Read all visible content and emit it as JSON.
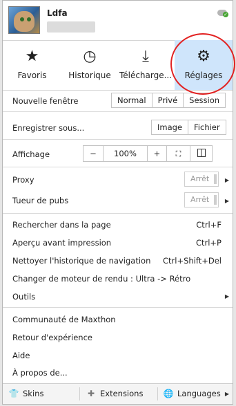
{
  "profile": {
    "username": "Ldfa"
  },
  "quick_actions": [
    {
      "label": "Favoris",
      "icon": "star-icon",
      "glyph": "★"
    },
    {
      "label": "Historique",
      "icon": "clock-icon",
      "glyph": "◷"
    },
    {
      "label": "Télécharge...",
      "icon": "download-icon",
      "glyph": "⤓"
    },
    {
      "label": "Réglages",
      "icon": "gear-icon",
      "glyph": "⚙"
    }
  ],
  "new_window": {
    "label": "Nouvelle fenêtre",
    "options": [
      "Normal",
      "Privé",
      "Session"
    ]
  },
  "save_as": {
    "label": "Enregistrer sous...",
    "options": [
      "Image",
      "Fichier"
    ]
  },
  "display": {
    "label": "Affichage",
    "minus": "−",
    "zoom": "100%",
    "plus": "+"
  },
  "proxy": {
    "label": "Proxy",
    "state": "Arrêt"
  },
  "adblock": {
    "label": "Tueur de pubs",
    "state": "Arrêt"
  },
  "items": {
    "find": {
      "label": "Rechercher dans la page",
      "shortcut": "Ctrl+F"
    },
    "print_preview": {
      "label": "Aperçu avant impression",
      "shortcut": "Ctrl+P"
    },
    "clear_history": {
      "label": "Nettoyer l'historique de navigation",
      "shortcut": "Ctrl+Shift+Del"
    },
    "render_engine": {
      "label": "Changer de moteur de rendu : Ultra -> Rétro"
    },
    "tools": {
      "label": "Outils"
    },
    "community": {
      "label": "Communauté de Maxthon"
    },
    "feedback": {
      "label": "Retour d'expérience"
    },
    "help": {
      "label": "Aide"
    },
    "about": {
      "label": "À propos de..."
    }
  },
  "bottom": {
    "skins": "Skins",
    "extensions": "Extensions",
    "languages": "Languages"
  },
  "colors": {
    "active_tile": "#cfe5fb",
    "highlight_ring": "#e22222",
    "sync_ok": "#47a433"
  }
}
